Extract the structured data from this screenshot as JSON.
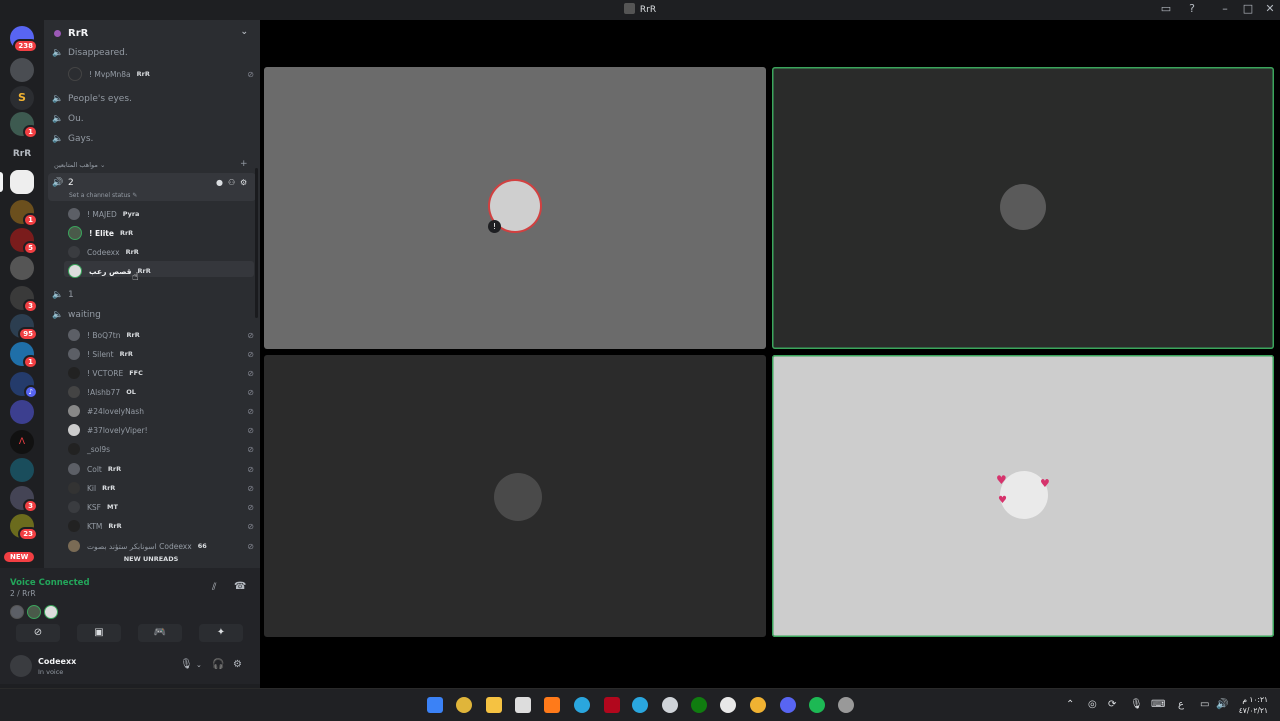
{
  "window": {
    "title": "RrR",
    "controls": [
      "inbox-icon",
      "help-icon",
      "minimize-icon",
      "maximize-icon",
      "close-icon"
    ]
  },
  "rail": {
    "top_badge": "238",
    "badges": [
      "1",
      "1",
      "5",
      "3",
      "95",
      "1",
      "3",
      "23"
    ],
    "new_label": "NEW"
  },
  "guild": {
    "name": "RrR"
  },
  "channels": {
    "disappeared": "Disappeared.",
    "disappeared_member": {
      "name": "! MvpMn8a",
      "tag": "RrR"
    },
    "peoples_eyes": "People's eyes.",
    "ou": "Ou.",
    "gays": "Gays.",
    "category": "مواهب المتابعين",
    "active_channel": "2",
    "set_status": "Set a channel status",
    "active_members": [
      {
        "name": "! MAJED",
        "tag": "Pyra"
      },
      {
        "name": "! Elite",
        "tag": "RrR"
      },
      {
        "name": "Codeexx",
        "tag": "RrR"
      },
      {
        "name": "قصص رعب",
        "tag": "RrR"
      }
    ],
    "one": "1",
    "waiting": "waiting",
    "waiting_members": [
      {
        "name": "! BoQ7tn",
        "tag": "RrR"
      },
      {
        "name": "! Silent",
        "tag": "RrR"
      },
      {
        "name": "! VCTORE",
        "tag": "FFC"
      },
      {
        "name": "!Alshb77",
        "tag": "OL"
      },
      {
        "name": "#24lovelyNash",
        "tag": ""
      },
      {
        "name": "#37lovelyViper!",
        "tag": ""
      },
      {
        "name": "_sol9s",
        "tag": ""
      },
      {
        "name": "Colt",
        "tag": "RrR"
      },
      {
        "name": "Kil",
        "tag": "RrR"
      },
      {
        "name": "KSF",
        "tag": "MT"
      },
      {
        "name": "KTM",
        "tag": "RrR"
      },
      {
        "name": "اسونابكر ستؤند بصوت Codeexx",
        "tag": "66"
      }
    ],
    "new_unreads": "NEW UNREADS"
  },
  "voice": {
    "status": "Voice Connected",
    "location": "2 / RrR"
  },
  "user": {
    "name": "Codeexx",
    "state": "In voice"
  },
  "clock": {
    "time": "١٠:٢١ م",
    "date": "٤٧/٠٢/٢١"
  },
  "tray_lang": "ع"
}
